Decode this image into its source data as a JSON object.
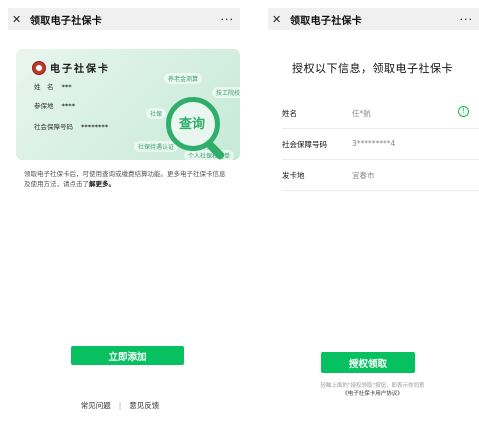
{
  "left": {
    "topbar": {
      "close_icon": "close-icon",
      "title": "领取电子社保卡",
      "more": "···"
    },
    "card": {
      "brand": "电子社保卡",
      "rows": [
        {
          "label": "姓　名",
          "value": "***"
        },
        {
          "label": "参保地",
          "value": "****"
        },
        {
          "label": "社会保障号码",
          "value": "********"
        }
      ],
      "tags": [
        "养老金测算",
        "技工院校",
        "社保",
        "社保待遇认证",
        "个人社保权益单"
      ],
      "query_label": "查询"
    },
    "desc": {
      "text": "领取电子社保卡后，可使用查询或缴费结算功能。更多电子社保卡信息及使用方法，请点击了",
      "link": "解更多。"
    },
    "button_add": "立即添加",
    "footer": {
      "faq": "常见问题",
      "sep": "|",
      "feedback": "意见反馈"
    }
  },
  "right": {
    "topbar": {
      "close_icon": "close-icon",
      "title": "领取电子社保卡",
      "more": "···"
    },
    "title": "授权以下信息，领取电子社保卡",
    "info": [
      {
        "label": "姓名",
        "value": "任*航"
      },
      {
        "label": "社会保障号码",
        "value": "3*********4"
      },
      {
        "label": "发卡地",
        "value": "宜春市"
      }
    ],
    "button_auth": "授权领取",
    "note_line": "轻触上面的\"授权领取\"按钮，即表示你同意",
    "agreement": "《电子社保卡用户协议》"
  },
  "colors": {
    "accent": "#07c160"
  }
}
